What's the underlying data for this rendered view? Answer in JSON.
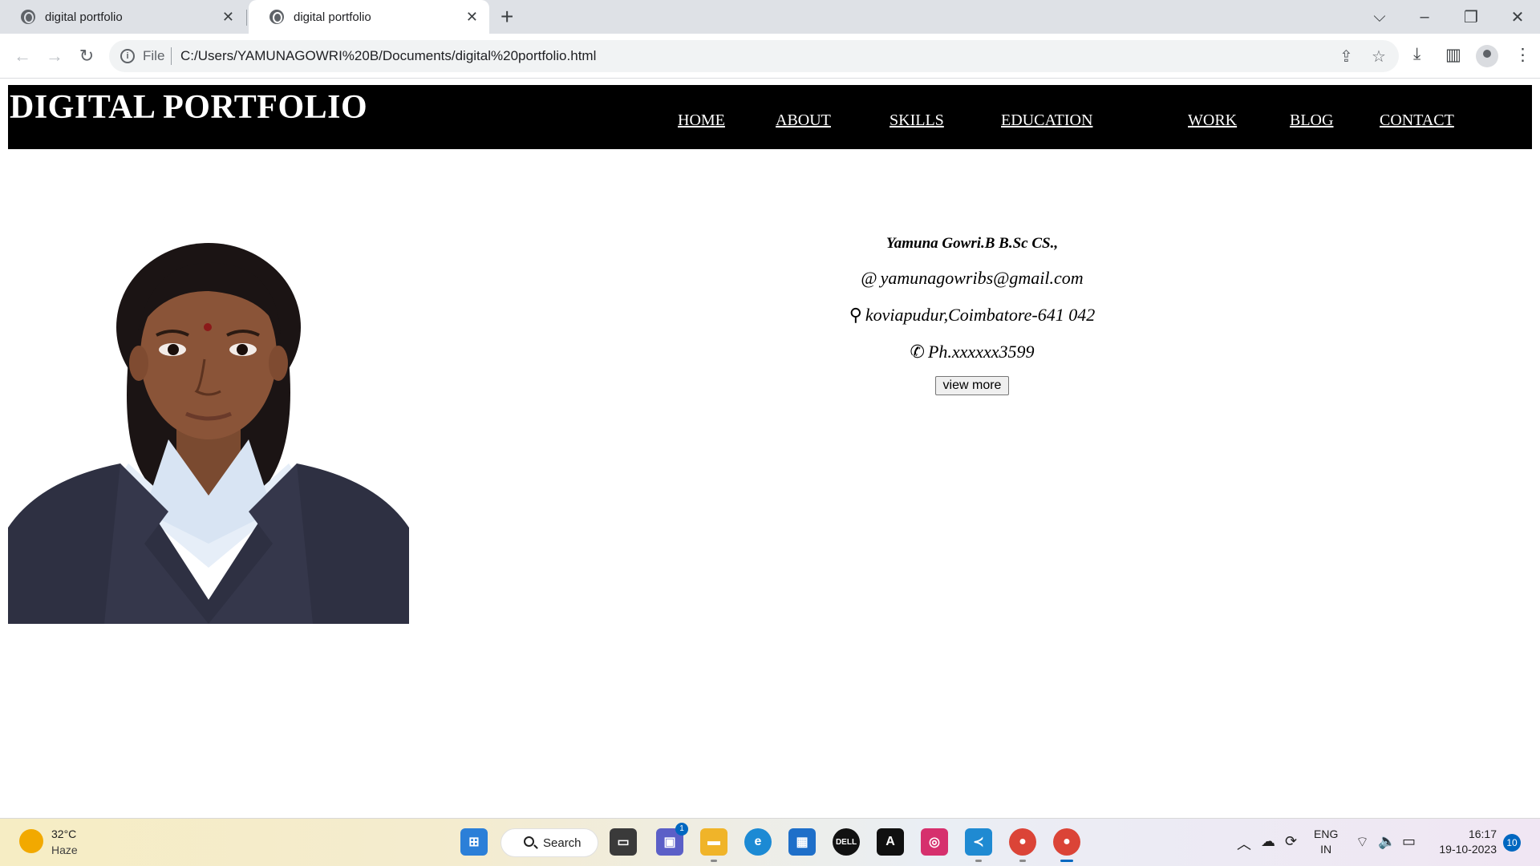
{
  "browser": {
    "tabs": [
      {
        "title": "digital portfolio",
        "active": false
      },
      {
        "title": "digital portfolio",
        "active": true
      }
    ],
    "new_tab": "+",
    "scheme_label": "File",
    "url": "C:/Users/YAMUNAGOWRI%20B/Documents/digital%20portfolio.html",
    "window_controls": {
      "minimize": "–",
      "restore": "❐",
      "close": "✕",
      "tab_search": "⌵"
    }
  },
  "site": {
    "title": "DIGITAL PORTFOLIO",
    "nav": [
      "HOME",
      "ABOUT",
      "SKILLS",
      "EDUCATION",
      "WORK",
      "BLOG",
      "CONTACT"
    ]
  },
  "profile": {
    "name": "Yamuna Gowri.B B.Sc CS.,",
    "email_icon": "@",
    "email": "yamunagowribs@gmail.com",
    "location_icon": "⚲",
    "location": "koviapudur,Coimbatore-641 042",
    "phone_icon": "✆",
    "phone": "Ph.xxxxxx3599",
    "button": "view more"
  },
  "taskbar": {
    "weather_temp": "32°C",
    "weather_desc": "Haze",
    "search_label": "Search",
    "teams_badge": "1",
    "lang_primary": "ENG",
    "lang_secondary": "IN",
    "time": "16:17",
    "date": "19-10-2023",
    "notification_count": "10"
  },
  "colors": {
    "header_bg": "#000000",
    "header_text": "#ffffff",
    "chrome_bg": "#dee1e6"
  }
}
